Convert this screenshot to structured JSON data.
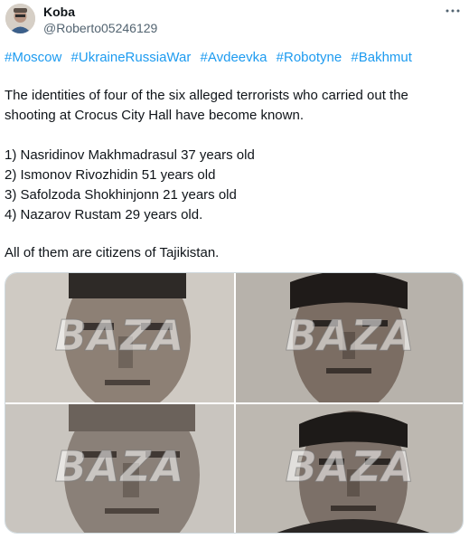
{
  "author": {
    "name": "Koba",
    "handle": "@Roberto05246129",
    "more_icon": "more-dots-icon"
  },
  "hashtags": [
    "#Moscow",
    "#UkraineRussiaWar",
    "#Avdeevka",
    "#Robotyne",
    "#Bakhmut"
  ],
  "body": {
    "line1": " The identities of four of the six alleged terrorists who carried out the",
    "line2": "shooting at Crocus City Hall have become known.",
    "list": [
      "1) Nasridinov Makhmadrasul 37 years old",
      "2) Ismonov Rivozhidin 51 years old",
      "3) Safolzoda Shokhinjonn 21 years old",
      "4) Nazarov Rustam 29 years old."
    ],
    "closing": "All of them are citizens of Tajikistan."
  },
  "media": {
    "watermark": "BAZA",
    "photos": [
      "photo-1",
      "photo-2",
      "photo-3",
      "photo-4"
    ]
  },
  "colors": {
    "link": "#1d9bf0",
    "muted": "#536471",
    "text": "#0f1419"
  }
}
